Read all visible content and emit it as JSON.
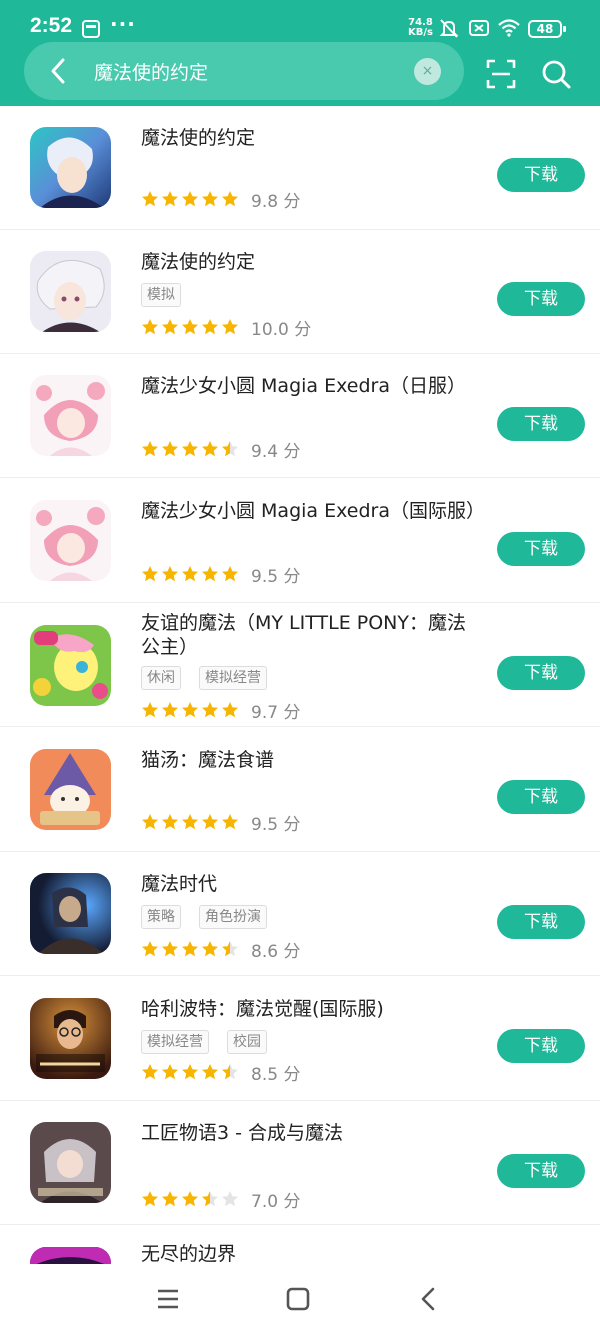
{
  "status_bar": {
    "time": "2:52",
    "more": "···",
    "net_speed": "74.8",
    "net_unit": "KB/s",
    "battery": "48"
  },
  "search": {
    "query": "魔法使的约定",
    "clear_symbol": "×"
  },
  "download_label": "下载",
  "score_unit": "分",
  "apps": [
    {
      "name": "魔法使的约定",
      "tags": [],
      "rating": 5,
      "score": "9.8"
    },
    {
      "name": "魔法使的约定",
      "tags": [
        "模拟"
      ],
      "rating": 5,
      "score": "10.0"
    },
    {
      "name": "魔法少女小圆 Magia Exedra（日服）",
      "tags": [],
      "rating": 4.5,
      "score": "9.4"
    },
    {
      "name": "魔法少女小圆 Magia Exedra（国际服）",
      "tags": [],
      "rating": 5,
      "score": "9.5"
    },
    {
      "name": "友谊的魔法（MY LITTLE PONY：魔法公主）",
      "tags": [
        "休闲",
        "模拟经营"
      ],
      "rating": 5,
      "score": "9.7"
    },
    {
      "name": "猫汤：魔法食谱",
      "tags": [],
      "rating": 5,
      "score": "9.5"
    },
    {
      "name": "魔法时代",
      "tags": [
        "策略",
        "角色扮演"
      ],
      "rating": 4.5,
      "score": "8.6"
    },
    {
      "name": "哈利波特：魔法觉醒(国际服)",
      "tags": [
        "模拟经营",
        "校园"
      ],
      "rating": 4.5,
      "score": "8.5"
    },
    {
      "name": "工匠物语3 - 合成与魔法",
      "tags": [],
      "rating": 3.5,
      "score": "7.0"
    },
    {
      "name": "无尽的边界",
      "tags": [],
      "rating": 0,
      "score": ""
    }
  ],
  "colors": {
    "accent": "#1fb99a",
    "star": "#f7b500",
    "star_empty": "#e4e4e4"
  },
  "icons": {
    "back": "chevron-left-icon",
    "clear": "close-icon",
    "scan": "scan-icon",
    "search": "search-icon",
    "nav_menu": "menu-icon",
    "nav_home": "home-icon",
    "nav_back": "back-icon"
  }
}
